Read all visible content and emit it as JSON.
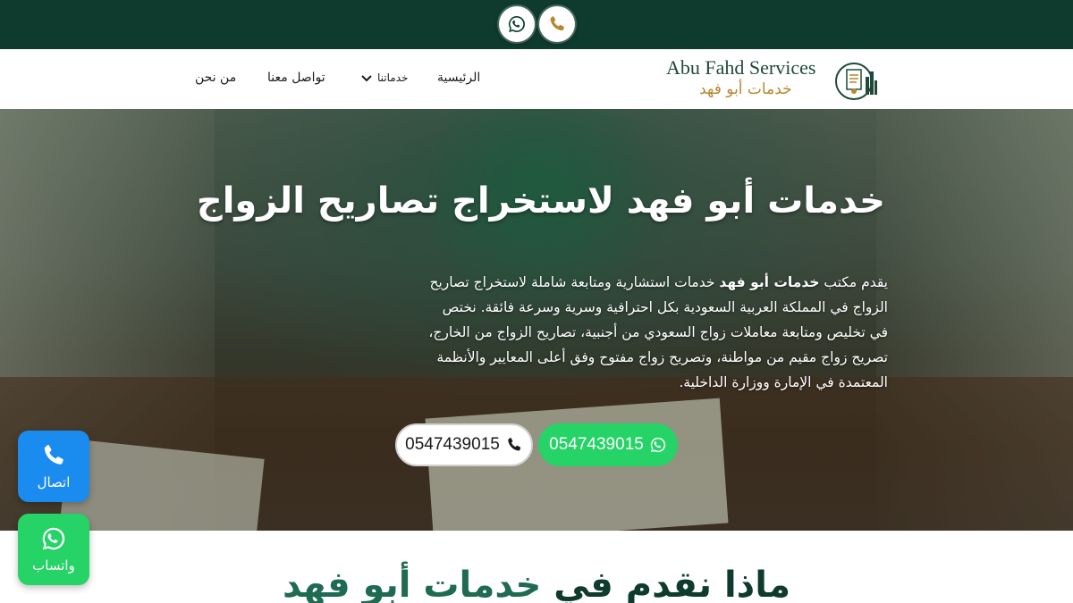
{
  "topbar": {
    "whatsapp_icon": "whatsapp-icon",
    "phone_icon": "phone-icon"
  },
  "logo": {
    "english": "Abu Fahd Services",
    "arabic": "خدمات أبو فهد"
  },
  "nav": {
    "home": "الرئيسية",
    "services": "خدماتنا",
    "contact": "تواصل معنا",
    "about": "من نحن"
  },
  "hero": {
    "title": "خدمات أبو فهد لاستخراج تصاريح الزواج",
    "text_prefix": "يقدم مكتب ",
    "text_bold": "خدمات أبو فهد",
    "text_rest": " خدمات استشارية ومتابعة شاملة لاستخراج تصاريح الزواج في المملكة العربية السعودية بكل احترافية وسرية وسرعة فائقة. نختص في تخليص ومتابعة معاملات زواج السعودي من أجنبية، تصاريح الزواج من الخارج، تصريح زواج مقيم من مواطنة، وتصريح زواج مفتوح وفق أعلى المعايير والأنظمة المعتمدة في الإمارة ووزارة الداخلية.",
    "whatsapp_number": "0547439015",
    "call_number": "0547439015"
  },
  "floating": {
    "call_label": "اتصال",
    "whatsapp_label": "واتساب"
  },
  "section": {
    "title_main": "ماذا نقدم في ",
    "title_accent": "خدمات أبو فهد"
  },
  "colors": {
    "dark_green": "#0e3b2e",
    "gold": "#b8862e",
    "whatsapp": "#25d366",
    "call_blue": "#1a8cf0"
  }
}
